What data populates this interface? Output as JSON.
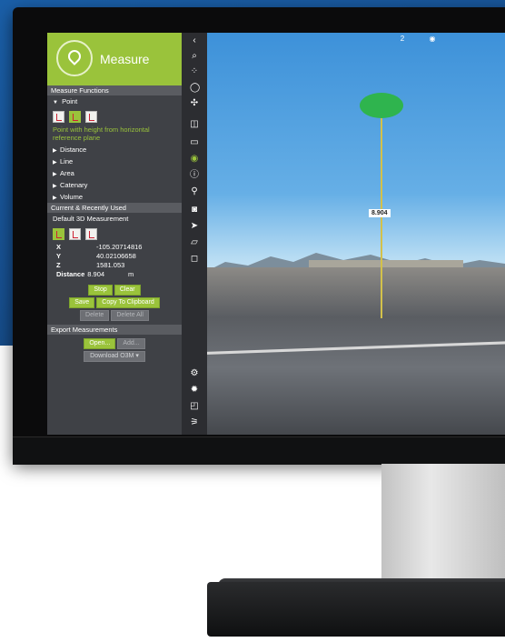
{
  "app": {
    "title": "Measure"
  },
  "functions": {
    "section_title": "Measure Functions",
    "point_label": "Point",
    "point_description": "Point with height from horizontal reference plane",
    "groups": [
      "Distance",
      "Line",
      "Area",
      "Catenary",
      "Volume"
    ]
  },
  "recent": {
    "section_title": "Current & Recently Used",
    "default_label": "Default 3D Measurement",
    "x_label": "X",
    "x_value": "-105.20714816",
    "y_label": "Y",
    "y_value": "40.02106658",
    "z_label": "Z",
    "z_value": "1581.053",
    "distance_label": "Distance",
    "distance_value": "8.904",
    "distance_unit": "m",
    "stop_label": "Stop",
    "clear_label": "Clear",
    "save_label": "Save",
    "copy_label": "Copy To Clipboard",
    "delete_label": "Delete",
    "delete_all_label": "Delete All"
  },
  "export": {
    "section_title": "Export Measurements",
    "open_label": "Open...",
    "add_label": "Add...",
    "download_label": "Download O3M"
  },
  "viewport": {
    "measure_value": "8.904",
    "top_icon_badge": "2"
  },
  "icons": {
    "toolbar": [
      "chevron-left-icon",
      "search-icon",
      "scatter-icon",
      "lasso-icon",
      "crosshair-icon",
      "cube-icon",
      "panel-icon",
      "measure-pin-icon",
      "info-icon",
      "marker-icon",
      "camera-icon",
      "send-icon",
      "polygon-icon",
      "bookmark-icon",
      "settings-gear-icon",
      "gear-icon",
      "layers-icon",
      "network-icon"
    ]
  },
  "colors": {
    "accent": "#9ac33b",
    "panel": "#3f4146",
    "section": "#5a5c61",
    "toolbar": "#2c2d31",
    "measure_ellipse": "#2fb44e"
  }
}
